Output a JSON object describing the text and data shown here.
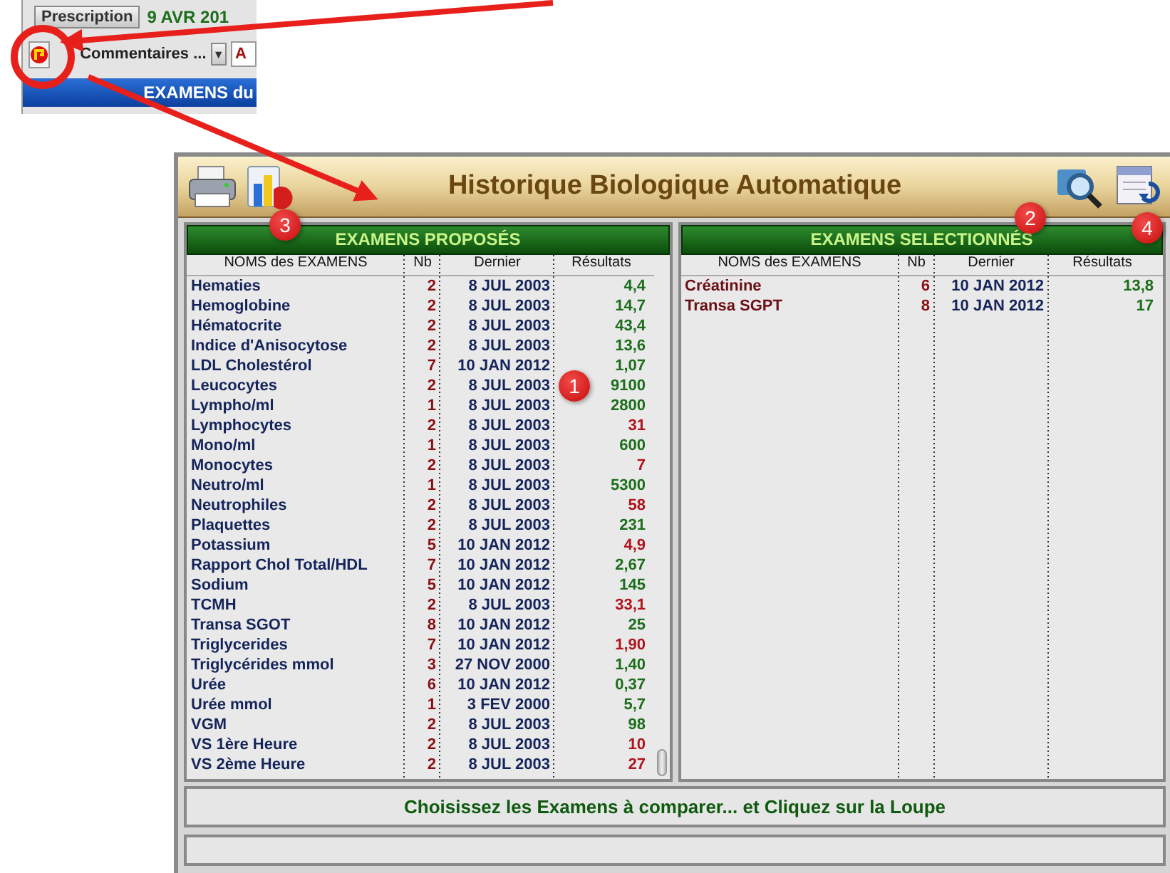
{
  "snippet": {
    "button": "Prescription",
    "date": "9 AVR 201",
    "comments": "Commentaires ...",
    "dropdown": "▼",
    "field": "A",
    "banner": "EXAMENS du"
  },
  "window": {
    "title": "Historique Biologique Automatique"
  },
  "panels": [
    {
      "title": "EXAMENS PROPOSÉS",
      "columns": [
        "NOMS des EXAMENS",
        "Nb",
        "Dernier",
        "Résultats"
      ],
      "kind": "proposed",
      "rows": [
        {
          "name": "Hematies",
          "nb": "2",
          "date": "8 JUL 2003",
          "result": "4,4",
          "color": "#1c6e1c"
        },
        {
          "name": "Hemoglobine",
          "nb": "2",
          "date": "8 JUL 2003",
          "result": "14,7",
          "color": "#1c6e1c"
        },
        {
          "name": "Hématocrite",
          "nb": "2",
          "date": "8 JUL 2003",
          "result": "43,4",
          "color": "#1c6e1c"
        },
        {
          "name": "Indice d'Anisocytose",
          "nb": "2",
          "date": "8 JUL 2003",
          "result": "13,6",
          "color": "#1c6e1c"
        },
        {
          "name": "LDL Cholestérol",
          "nb": "7",
          "date": "10 JAN 2012",
          "result": "1,07",
          "color": "#1c6e1c"
        },
        {
          "name": "Leucocytes",
          "nb": "2",
          "date": "8 JUL 2003",
          "result": "9100",
          "color": "#1c6e1c"
        },
        {
          "name": "Lympho/ml",
          "nb": "1",
          "date": "8 JUL 2003",
          "result": "2800",
          "color": "#1c6e1c"
        },
        {
          "name": "Lymphocytes",
          "nb": "2",
          "date": "8 JUL 2003",
          "result": "31",
          "color": "#b0141e"
        },
        {
          "name": "Mono/ml",
          "nb": "1",
          "date": "8 JUL 2003",
          "result": "600",
          "color": "#1c6e1c"
        },
        {
          "name": "Monocytes",
          "nb": "2",
          "date": "8 JUL 2003",
          "result": "7",
          "color": "#b0141e"
        },
        {
          "name": "Neutro/ml",
          "nb": "1",
          "date": "8 JUL 2003",
          "result": "5300",
          "color": "#1c6e1c"
        },
        {
          "name": "Neutrophiles",
          "nb": "2",
          "date": "8 JUL 2003",
          "result": "58",
          "color": "#b0141e"
        },
        {
          "name": "Plaquettes",
          "nb": "2",
          "date": "8 JUL 2003",
          "result": "231",
          "color": "#1c6e1c"
        },
        {
          "name": "Potassium",
          "nb": "5",
          "date": "10 JAN 2012",
          "result": "4,9",
          "color": "#b0141e"
        },
        {
          "name": "Rapport Chol Total/HDL",
          "nb": "7",
          "date": "10 JAN 2012",
          "result": "2,67",
          "color": "#1c6e1c"
        },
        {
          "name": "Sodium",
          "nb": "5",
          "date": "10 JAN 2012",
          "result": "145",
          "color": "#1c6e1c"
        },
        {
          "name": "TCMH",
          "nb": "2",
          "date": "8 JUL 2003",
          "result": "33,1",
          "color": "#b0141e"
        },
        {
          "name": "Transa SGOT",
          "nb": "8",
          "date": "10 JAN 2012",
          "result": "25",
          "color": "#1c6e1c"
        },
        {
          "name": "Triglycerides",
          "nb": "7",
          "date": "10 JAN 2012",
          "result": "1,90",
          "color": "#b0141e"
        },
        {
          "name": "Triglycérides mmol",
          "nb": "3",
          "date": "27 NOV 2000",
          "result": "1,40",
          "color": "#1c6e1c"
        },
        {
          "name": "Urée",
          "nb": "6",
          "date": "10 JAN 2012",
          "result": "0,37",
          "color": "#1c6e1c"
        },
        {
          "name": "Urée mmol",
          "nb": "1",
          "date": "3 FEV 2000",
          "result": "5,7",
          "color": "#1c6e1c"
        },
        {
          "name": "VGM",
          "nb": "2",
          "date": "8 JUL 2003",
          "result": "98",
          "color": "#1c6e1c"
        },
        {
          "name": "VS 1ère Heure",
          "nb": "2",
          "date": "8 JUL 2003",
          "result": "10",
          "color": "#b0141e"
        },
        {
          "name": "VS 2ème Heure",
          "nb": "2",
          "date": "8 JUL 2003",
          "result": "27",
          "color": "#b0141e"
        }
      ]
    },
    {
      "title": "EXAMENS SELECTIONNÉS",
      "columns": [
        "NOMS des EXAMENS",
        "Nb",
        "Dernier",
        "Résultats"
      ],
      "kind": "selected",
      "rows": [
        {
          "name": "Créatinine",
          "nb": "6",
          "date": "10 JAN 2012",
          "result": "13,8",
          "color": "#1c6e1c"
        },
        {
          "name": "Transa SGPT",
          "nb": "8",
          "date": "10 JAN 2012",
          "result": "17",
          "color": "#1c6e1c"
        }
      ]
    }
  ],
  "message": "Choisissez les Examens à comparer... et Cliquez sur la Loupe",
  "callouts": [
    {
      "label": "1"
    },
    {
      "label": "2"
    },
    {
      "label": "3"
    },
    {
      "label": "4"
    }
  ]
}
